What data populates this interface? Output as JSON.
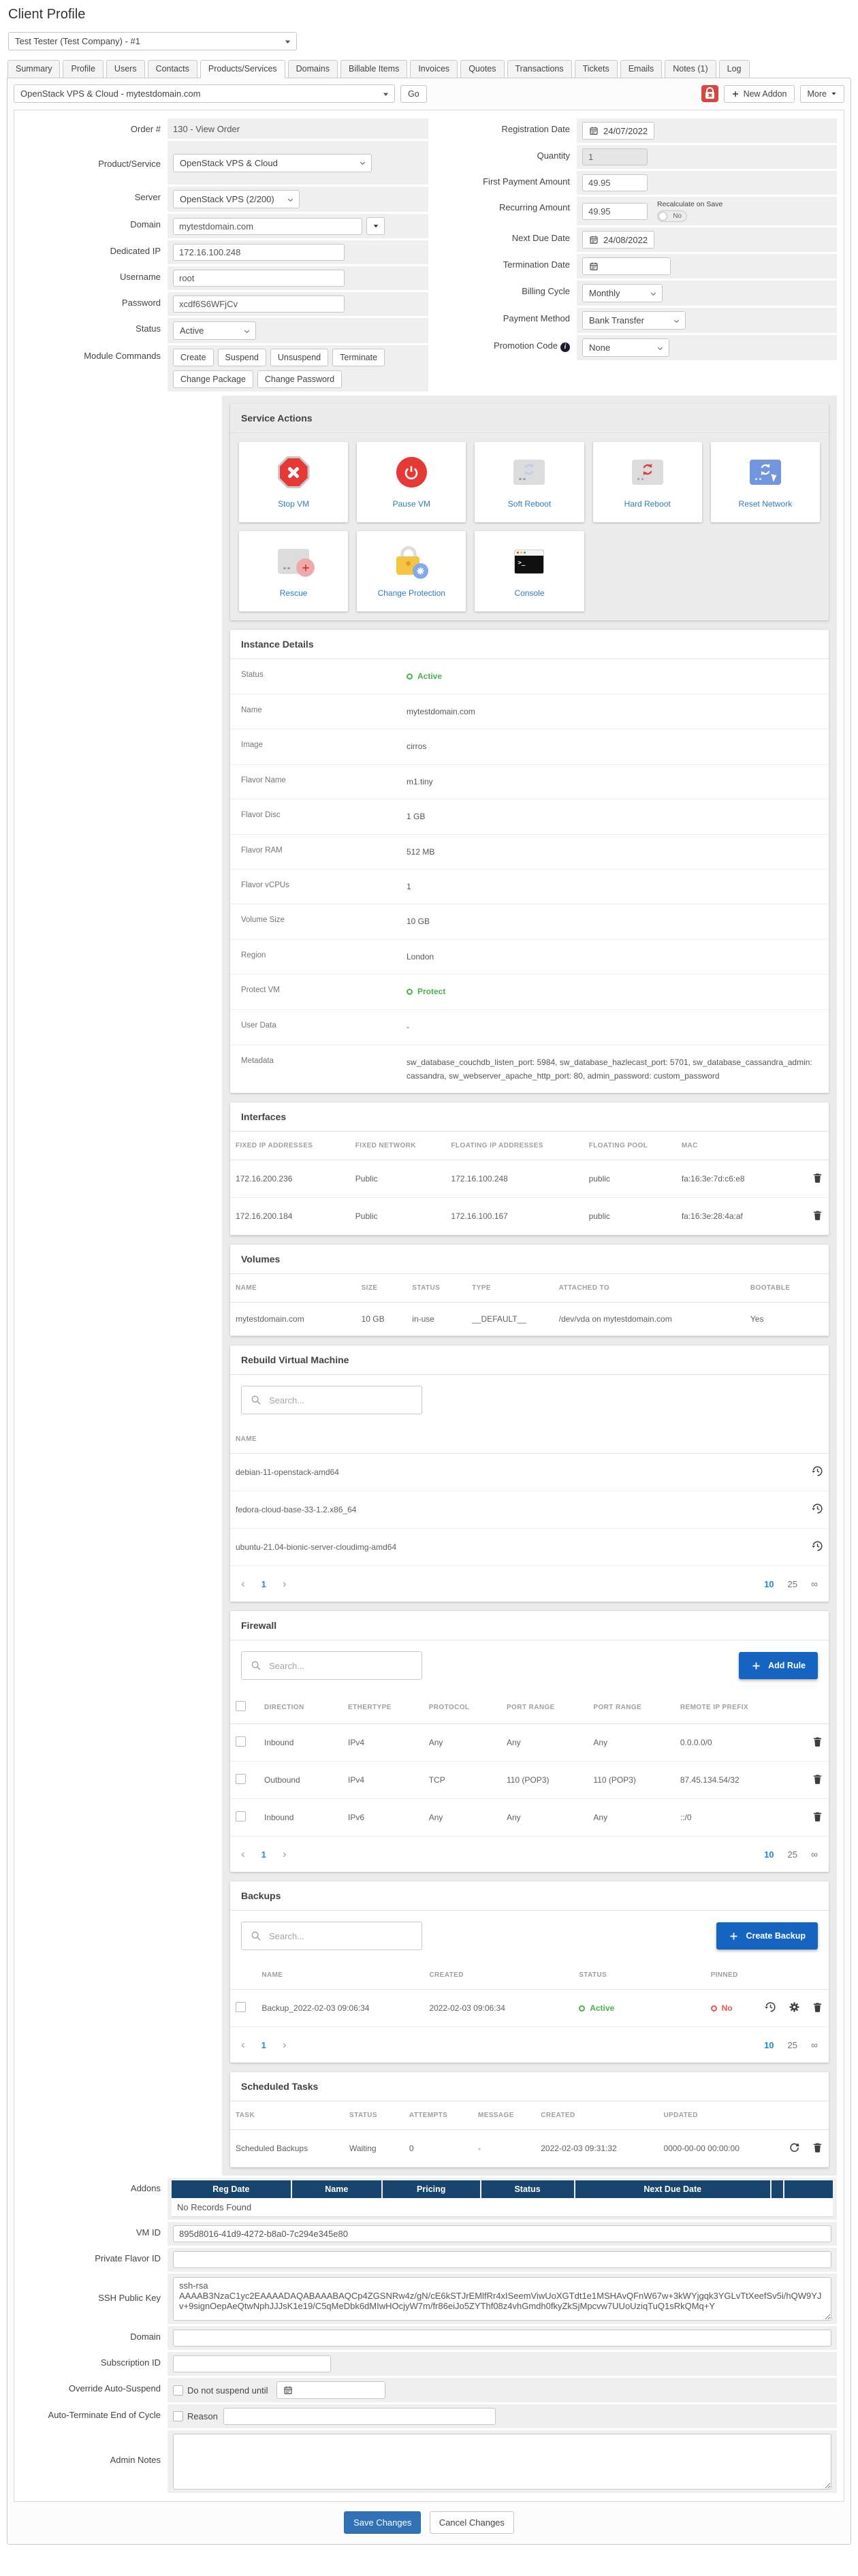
{
  "colors": {
    "accent_blue": "#1565c0",
    "save_blue": "#2f73b6",
    "navy_header": "#17456e",
    "status_green": "#4caf50",
    "status_red": "#ef5350",
    "link_blue": "#2d7cc4",
    "module_bg": "#ebebeb",
    "field_bg": "#efefef"
  },
  "header": {
    "title": "Client Profile"
  },
  "client_selector": {
    "value": "Test Tester (Test Company) - #1"
  },
  "tabs": {
    "items": [
      "Summary",
      "Profile",
      "Users",
      "Contacts",
      "Products/Services",
      "Domains",
      "Billable Items",
      "Invoices",
      "Quotes",
      "Transactions",
      "Tickets",
      "Emails",
      "Notes (1)",
      "Log"
    ],
    "active": "Products/Services"
  },
  "toolbar": {
    "service_select": "OpenStack VPS & Cloud - mytestdomain.com",
    "go": "Go",
    "new_addon": "New Addon",
    "more": "More"
  },
  "service_form": {
    "order": {
      "label": "Order #",
      "value": "130 - View Order"
    },
    "product": {
      "label": "Product/Service",
      "value": "OpenStack VPS & Cloud"
    },
    "server": {
      "label": "Server",
      "value": "OpenStack VPS (2/200)"
    },
    "domain": {
      "label": "Domain",
      "value": "mytestdomain.com"
    },
    "dedicated_ip": {
      "label": "Dedicated IP",
      "value": "172.16.100.248"
    },
    "username": {
      "label": "Username",
      "value": "root"
    },
    "password": {
      "label": "Password",
      "value": "xcdf6S6WFjCv"
    },
    "status": {
      "label": "Status",
      "value": "Active"
    },
    "module_commands": {
      "label": "Module Commands",
      "buttons": [
        "Create",
        "Suspend",
        "Unsuspend",
        "Terminate",
        "Change Package",
        "Change Password"
      ]
    },
    "registration_date": {
      "label": "Registration Date",
      "value": "24/07/2022"
    },
    "quantity": {
      "label": "Quantity",
      "value": "1"
    },
    "first_payment": {
      "label": "First Payment Amount",
      "value": "49.95"
    },
    "recurring": {
      "label": "Recurring Amount",
      "value": "49.95",
      "recalc_label": "Recalculate on Save",
      "recalc_value": "No"
    },
    "next_due": {
      "label": "Next Due Date",
      "value": "24/08/2022"
    },
    "termination_date": {
      "label": "Termination Date",
      "value": ""
    },
    "billing_cycle": {
      "label": "Billing Cycle",
      "value": "Monthly"
    },
    "payment_method": {
      "label": "Payment Method",
      "value": "Bank Transfer"
    },
    "promotion_code": {
      "label": "Promotion Code",
      "value": "None"
    }
  },
  "service_actions": {
    "title": "Service Actions",
    "tiles": [
      {
        "label": "Stop VM",
        "icon": "stop-octagon-icon"
      },
      {
        "label": "Pause VM",
        "icon": "power-circle-icon"
      },
      {
        "label": "Soft Reboot",
        "icon": "server-sync-blue-icon"
      },
      {
        "label": "Hard Reboot",
        "icon": "server-sync-red-icon"
      },
      {
        "label": "Reset Network",
        "icon": "server-network-icon"
      },
      {
        "label": "Rescue",
        "icon": "server-plus-icon"
      },
      {
        "label": "Change Protection",
        "icon": "padlock-gear-icon"
      },
      {
        "label": "Console",
        "icon": "terminal-icon"
      }
    ]
  },
  "instance_details": {
    "title": "Instance Details",
    "rows": [
      {
        "label": "Status",
        "value": "Active"
      },
      {
        "label": "Name",
        "value": "mytestdomain.com"
      },
      {
        "label": "Image",
        "value": "cirros"
      },
      {
        "label": "Flavor Name",
        "value": "m1.tiny"
      },
      {
        "label": "Flavor Disc",
        "value": "1 GB"
      },
      {
        "label": "Flavor RAM",
        "value": "512 MB"
      },
      {
        "label": "Flavor vCPUs",
        "value": "1"
      },
      {
        "label": "Volume Size",
        "value": "10 GB"
      },
      {
        "label": "Region",
        "value": "London"
      },
      {
        "label": "Protect VM",
        "value": "Protect"
      },
      {
        "label": "User Data",
        "value": "-"
      },
      {
        "label": "Metadata",
        "value": "sw_database_couchdb_listen_port: 5984, sw_database_hazlecast_port: 5701, sw_database_cassandra_admin: cassandra, sw_webserver_apache_http_port: 80, admin_password: custom_password"
      }
    ]
  },
  "interfaces": {
    "title": "Interfaces",
    "headers": [
      "FIXED IP ADDRESSES",
      "FIXED NETWORK",
      "FLOATING IP ADDRESSES",
      "FLOATING POOL",
      "MAC"
    ],
    "rows": [
      {
        "fixed_ip": "172.16.200.236",
        "fixed_network": "Public",
        "floating_ip": "172.16.100.248",
        "floating_pool": "public",
        "mac": "fa:16:3e:7d:c6:e8"
      },
      {
        "fixed_ip": "172.16.200.184",
        "fixed_network": "Public",
        "floating_ip": "172.16.100.167",
        "floating_pool": "public",
        "mac": "fa:16:3e:28:4a:af"
      }
    ]
  },
  "volumes": {
    "title": "Volumes",
    "headers": [
      "NAME",
      "SIZE",
      "STATUS",
      "TYPE",
      "ATTACHED TO",
      "BOOTABLE"
    ],
    "rows": [
      {
        "name": "mytestdomain.com",
        "size": "10 GB",
        "status": "in-use",
        "type": "__DEFAULT__",
        "attached_to": "/dev/vda on mytestdomain.com",
        "bootable": "Yes"
      }
    ]
  },
  "rebuild": {
    "title": "Rebuild Virtual Machine",
    "search_placeholder": "Search...",
    "header": "NAME",
    "rows": [
      "debian-11-openstack-amd64",
      "fedora-cloud-base-33-1.2.x86_64",
      "ubuntu-21.04-bionic-server-cloudimg-amd64"
    ],
    "pagination": {
      "page": "1",
      "size_10": "10",
      "size_25": "25",
      "size_all": "∞"
    }
  },
  "firewall": {
    "title": "Firewall",
    "search_placeholder": "Search...",
    "add_rule": "Add Rule",
    "headers": [
      "DIRECTION",
      "ETHERTYPE",
      "PROTOCOL",
      "PORT RANGE",
      "PORT RANGE",
      "REMOTE IP PREFIX"
    ],
    "rows": [
      {
        "direction": "Inbound",
        "ethertype": "IPv4",
        "protocol": "Any",
        "port_min": "Any",
        "port_max": "Any",
        "remote_ip": "0.0.0.0/0"
      },
      {
        "direction": "Outbound",
        "ethertype": "IPv4",
        "protocol": "TCP",
        "port_min": "110 (POP3)",
        "port_max": "110 (POP3)",
        "remote_ip": "87.45.134.54/32"
      },
      {
        "direction": "Inbound",
        "ethertype": "IPv6",
        "protocol": "Any",
        "port_min": "Any",
        "port_max": "Any",
        "remote_ip": "::/0"
      }
    ],
    "pagination": {
      "page": "1",
      "size_10": "10",
      "size_25": "25",
      "size_all": "∞"
    }
  },
  "backups": {
    "title": "Backups",
    "search_placeholder": "Search...",
    "create_backup": "Create Backup",
    "headers": [
      "NAME",
      "CREATED",
      "STATUS",
      "PINNED"
    ],
    "rows": [
      {
        "name": "Backup_2022-02-03 09:06:34",
        "created": "2022-02-03 09:06:34",
        "status": "Active",
        "pinned": "No"
      }
    ],
    "pagination": {
      "page": "1",
      "size_10": "10",
      "size_25": "25",
      "size_all": "∞"
    }
  },
  "scheduled_tasks": {
    "title": "Scheduled Tasks",
    "headers": [
      "TASK",
      "STATUS",
      "ATTEMPTS",
      "MESSAGE",
      "CREATED",
      "UPDATED"
    ],
    "rows": [
      {
        "task": "Scheduled Backups",
        "status": "Waiting",
        "attempts": "0",
        "message": "-",
        "created": "2022-02-03 09:31:32",
        "updated": "0000-00-00 00:00:00"
      }
    ]
  },
  "addons": {
    "label": "Addons",
    "headers": [
      "Reg Date",
      "Name",
      "Pricing",
      "Status",
      "Next Due Date"
    ],
    "empty": "No Records Found"
  },
  "extra_fields": {
    "vm_id": {
      "label": "VM ID",
      "value": "895d8016-41d9-4272-b8a0-7c294e345e80"
    },
    "private_flavor_id": {
      "label": "Private Flavor ID",
      "value": ""
    },
    "ssh_public_key": {
      "label": "SSH Public Key",
      "value": "ssh-rsa AAAAB3NzaC1yc2EAAAADAQABAAABAQCp4ZGSNRw4z/gN/cE6kSTJrEMlfRr4xISeemViwUoXGTdt1e1MSHAvQFnW67w+3kWYjgqk3YGLvTtXeefSv5i/hQW9YJv+9signOepAeQtwNphJJJsK1e19/C5qMeDbk6dMIwHOcjyW7m/fr86eiJo5ZYThf08z4vhGmdh0fkyZkSjMpcvw7UUoUziqTuQ1sRkQMq+Y"
    },
    "domain": {
      "label": "Domain",
      "value": ""
    },
    "subscription_id": {
      "label": "Subscription ID",
      "value": ""
    },
    "override_auto_suspend": {
      "label": "Override Auto-Suspend",
      "checkbox_label": "Do not suspend until"
    },
    "auto_terminate": {
      "label": "Auto-Terminate End of Cycle",
      "checkbox_label": "Reason"
    },
    "admin_notes": {
      "label": "Admin Notes"
    }
  },
  "footer": {
    "save": "Save Changes",
    "cancel": "Cancel Changes"
  }
}
